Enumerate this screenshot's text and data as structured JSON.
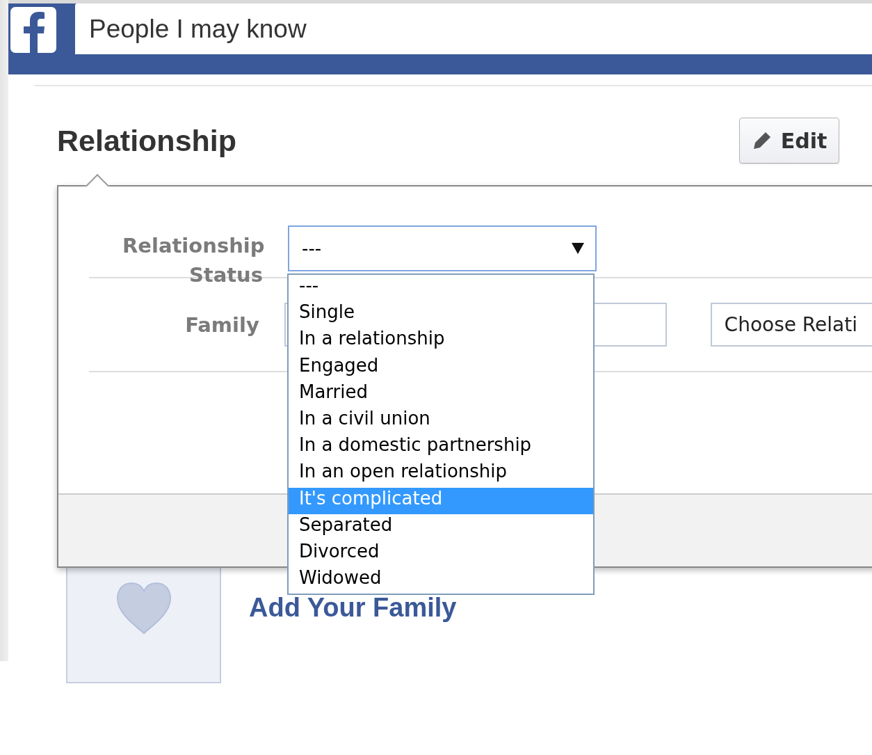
{
  "header": {
    "title": "People I may know"
  },
  "section": {
    "title": "Relationship",
    "edit_button": "Edit"
  },
  "form": {
    "status_label": "Relationship Status",
    "status_select": {
      "value": "---",
      "expanded": true
    },
    "options": [
      {
        "label": "---",
        "selected": false
      },
      {
        "label": "Single",
        "selected": false
      },
      {
        "label": "In a relationship",
        "selected": false
      },
      {
        "label": "Engaged",
        "selected": false
      },
      {
        "label": "Married",
        "selected": false
      },
      {
        "label": "In a civil union",
        "selected": false
      },
      {
        "label": "In a domestic partnership",
        "selected": false
      },
      {
        "label": "In an open relationship",
        "selected": false
      },
      {
        "label": "It's complicated",
        "selected": true
      },
      {
        "label": "Separated",
        "selected": false
      },
      {
        "label": "Divorced",
        "selected": false
      },
      {
        "label": "Widowed",
        "selected": false
      }
    ],
    "family_label": "Family",
    "relation_select": {
      "value": "Choose Relati"
    }
  },
  "add_family": {
    "title": "Add Your Family"
  }
}
